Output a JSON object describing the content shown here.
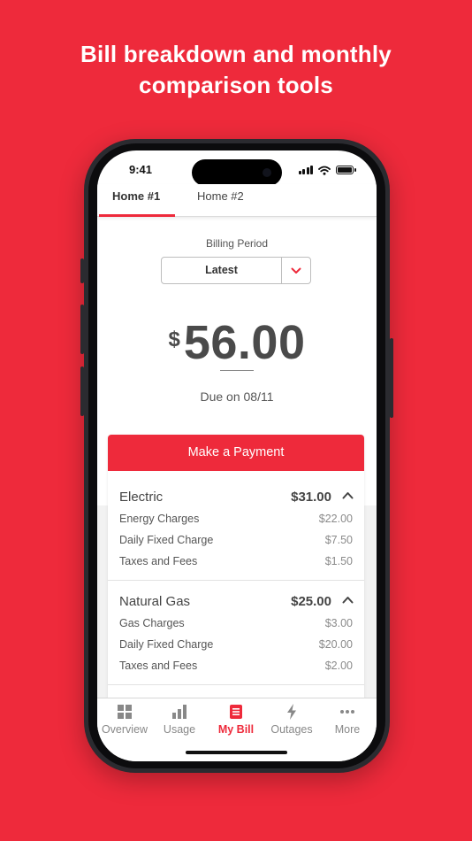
{
  "headline": [
    "Bill breakdown and  monthly",
    "comparison tools"
  ],
  "status_bar": {
    "time": "9:41"
  },
  "tabs": [
    {
      "label": "Home #1",
      "active": true
    },
    {
      "label": "Home #2",
      "active": false
    }
  ],
  "billing": {
    "label": "Billing Period",
    "selected_period": "Latest",
    "currency_symbol": "$",
    "amount": "56.00",
    "due": "Due on 08/11"
  },
  "payment_button": "Make a Payment",
  "sections": [
    {
      "title": "Electric",
      "total": "$31.00",
      "expanded": true,
      "lines": [
        {
          "label": "Energy Charges",
          "amount": "$22.00"
        },
        {
          "label": "Daily Fixed Charge",
          "amount": "$7.50"
        },
        {
          "label": "Taxes and Fees",
          "amount": "$1.50"
        }
      ]
    },
    {
      "title": "Natural Gas",
      "total": "$25.00",
      "expanded": true,
      "lines": [
        {
          "label": "Gas Charges",
          "amount": "$3.00"
        },
        {
          "label": "Daily Fixed Charge",
          "amount": "$20.00"
        },
        {
          "label": "Taxes and Fees",
          "amount": "$2.00"
        }
      ]
    }
  ],
  "nav": [
    {
      "label": "Overview",
      "icon": "grid-icon",
      "active": false
    },
    {
      "label": "Usage",
      "icon": "bar-chart-icon",
      "active": false
    },
    {
      "label": "My Bill",
      "icon": "bill-icon",
      "active": true
    },
    {
      "label": "Outages",
      "icon": "lightning-icon",
      "active": false
    },
    {
      "label": "More",
      "icon": "more-dots-icon",
      "active": false
    }
  ],
  "colors": {
    "brand": "#ee2a3b",
    "text": "#444444",
    "muted": "#8a8a8a"
  }
}
